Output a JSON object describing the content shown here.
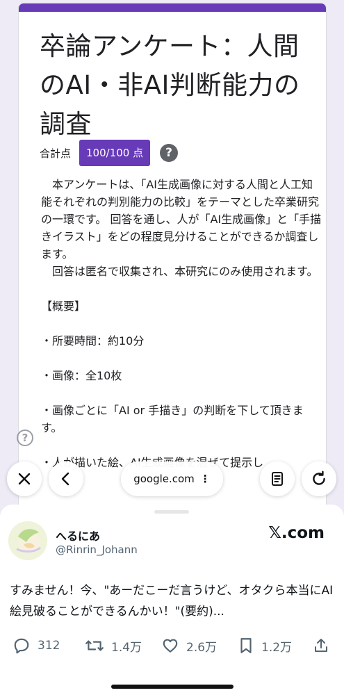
{
  "form": {
    "title": "卒論アンケート：人間のAI・非AI判断能力の調査",
    "score_label": "合計点",
    "score_value": "100/100 点",
    "help_icon": "?",
    "description": [
      "　本アンケートは、「AI生成画像に対する人間と人工知能それぞれの判別能力の比較」をテーマとした卒業研究の一環です。 回答を通し、人が「AI生成画像」と「手描きイラスト」をどの程度見分けることができるか調査します。",
      "　回答は匿名で収集され、本研究にのみ使用されます。",
      "",
      "【概要】",
      "",
      "・所要時間：約10分",
      "",
      "・画像：全10枚",
      "",
      "・画像ごとに「AI or 手描き」の判断を下して頂きます。",
      "",
      "・人が描いた絵、AI生成画像を混ぜて提示し"
    ]
  },
  "browser": {
    "url": "google.com",
    "menu_glyph": "⋮",
    "icons": [
      "close-icon",
      "back-icon",
      "reader-icon",
      "reload-icon"
    ]
  },
  "tweet": {
    "display_name": "へるにあ",
    "handle": "@Rinrin_Johann",
    "brand": "𝕏.com",
    "text": "すみません！今、\"あーだこーだ言うけど、オタクら本当にAI絵見破ることができるんかい！\"(要約)...",
    "stats": {
      "replies": "312",
      "retweets": "1.4万",
      "likes": "2.6万",
      "bookmarks": "1.2万"
    }
  },
  "colors": {
    "accent": "#673ab7",
    "page_bg": "#efebf6"
  }
}
